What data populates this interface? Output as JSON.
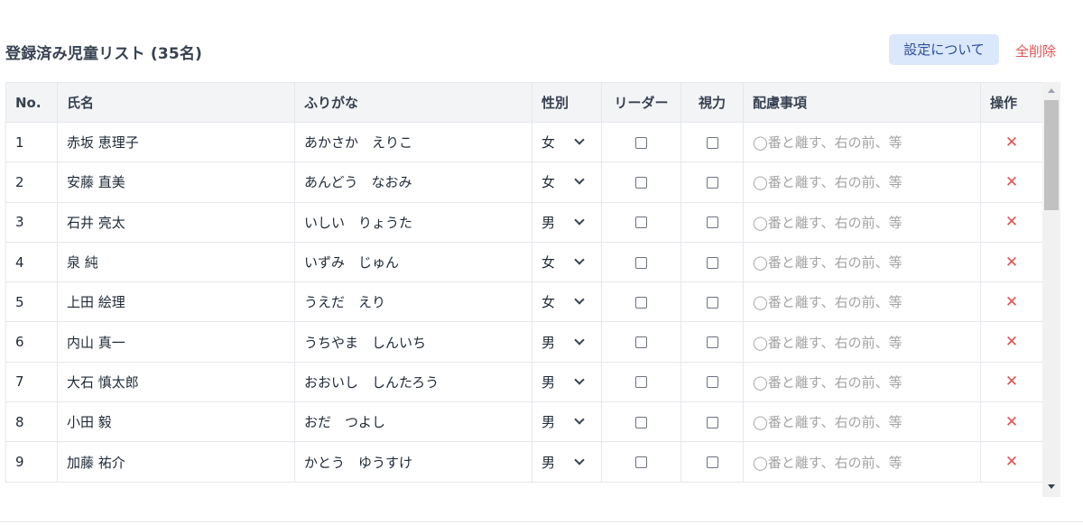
{
  "header": {
    "title": "登録済み児童リスト (35名)",
    "settings_label": "設定について",
    "delete_all_label": "全削除"
  },
  "table": {
    "columns": [
      "No.",
      "氏名",
      "ふりがな",
      "性別",
      "リーダー",
      "視力",
      "配慮事項",
      "操作"
    ],
    "note_placeholder": "◯番と離す、右の前、等",
    "rows": [
      {
        "no": "1",
        "name": "赤坂 恵理子",
        "furigana": "あかさか　えりこ",
        "gender": "女"
      },
      {
        "no": "2",
        "name": "安藤 直美",
        "furigana": "あんどう　なおみ",
        "gender": "女"
      },
      {
        "no": "3",
        "name": "石井 亮太",
        "furigana": "いしい　りょうた",
        "gender": "男"
      },
      {
        "no": "4",
        "name": "泉 純",
        "furigana": "いずみ　じゅん",
        "gender": "女"
      },
      {
        "no": "5",
        "name": "上田 絵理",
        "furigana": "うえだ　えり",
        "gender": "女"
      },
      {
        "no": "6",
        "name": "内山 真一",
        "furigana": "うちやま　しんいち",
        "gender": "男"
      },
      {
        "no": "7",
        "name": "大石 慎太郎",
        "furigana": "おおいし　しんたろう",
        "gender": "男"
      },
      {
        "no": "8",
        "name": "小田 毅",
        "furigana": "おだ　つよし",
        "gender": "男"
      },
      {
        "no": "9",
        "name": "加藤 祐介",
        "furigana": "かとう　ゆうすけ",
        "gender": "男"
      }
    ]
  },
  "icons": {
    "delete_row": "close-icon",
    "select_arrow": "chevron-down-icon"
  },
  "colors": {
    "accent_bg": "#dbe7fb",
    "accent_text": "#2b4f9e",
    "danger": "#e05252"
  }
}
